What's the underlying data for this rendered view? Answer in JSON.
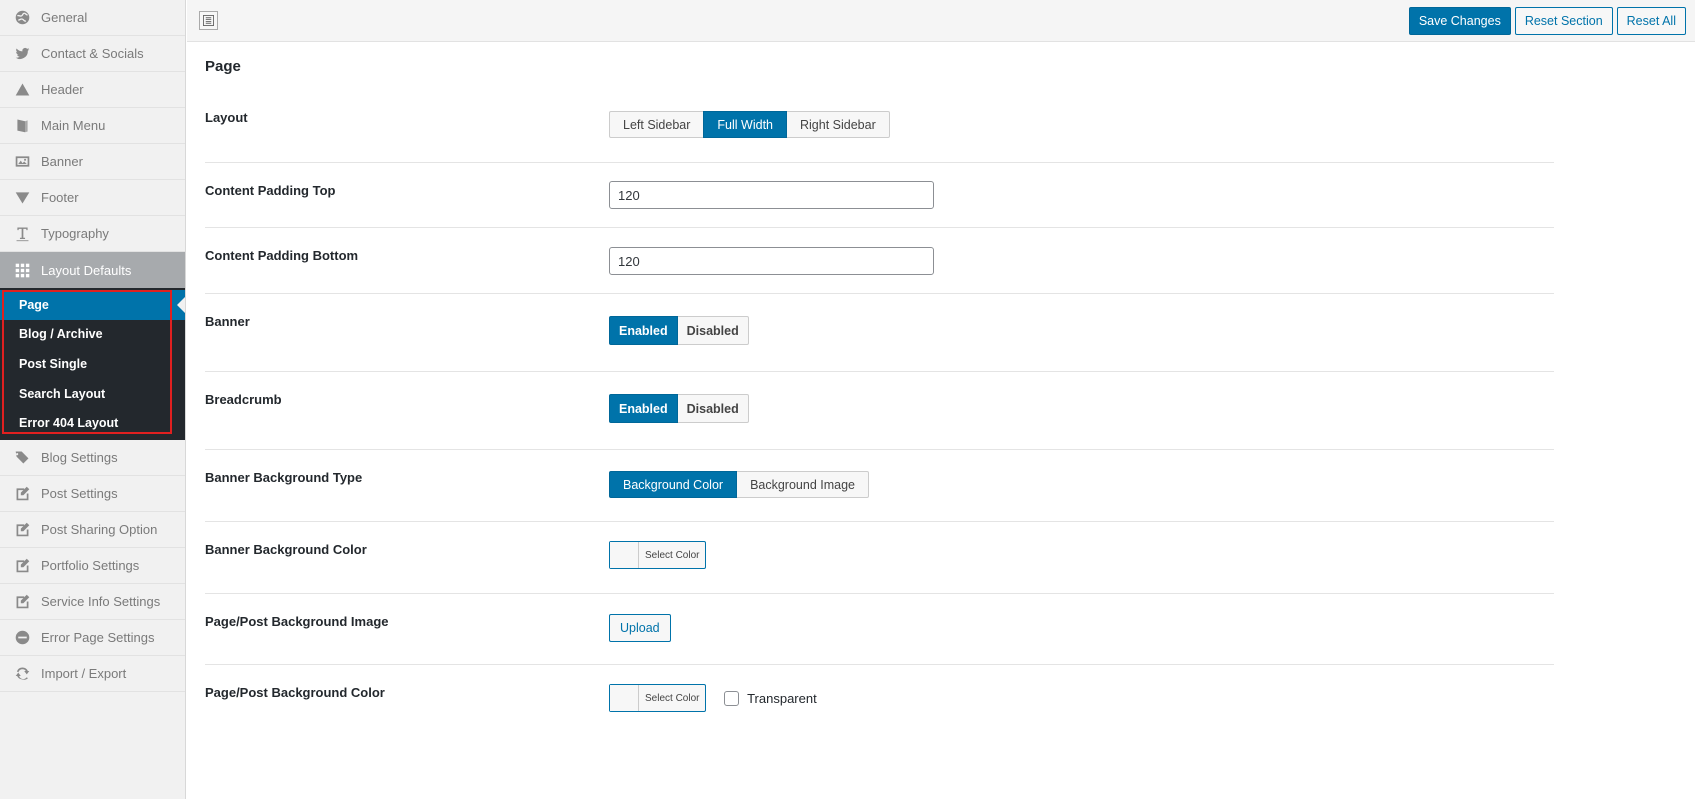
{
  "sidebar": {
    "items": [
      {
        "label": "General",
        "icon": "globe-icon"
      },
      {
        "label": "Contact & Socials",
        "icon": "twitter-icon"
      },
      {
        "label": "Header",
        "icon": "triangle-up-icon"
      },
      {
        "label": "Main Menu",
        "icon": "book-icon"
      },
      {
        "label": "Banner",
        "icon": "image-icon"
      },
      {
        "label": "Footer",
        "icon": "triangle-down-icon"
      },
      {
        "label": "Typography",
        "icon": "text-icon"
      },
      {
        "label": "Layout Defaults",
        "icon": "grid-icon"
      }
    ],
    "subitems": [
      "Page",
      "Blog / Archive",
      "Post Single",
      "Search Layout",
      "Error 404 Layout"
    ],
    "items_after": [
      {
        "label": "Blog Settings",
        "icon": "tags-icon"
      },
      {
        "label": "Post Settings",
        "icon": "edit-icon"
      },
      {
        "label": "Post Sharing Option",
        "icon": "edit-icon"
      },
      {
        "label": "Portfolio Settings",
        "icon": "edit-icon"
      },
      {
        "label": "Service Info Settings",
        "icon": "edit-icon"
      },
      {
        "label": "Error Page Settings",
        "icon": "minus-circle-icon"
      },
      {
        "label": "Import / Export",
        "icon": "refresh-icon"
      }
    ]
  },
  "toolbar": {
    "save_label": "Save Changes",
    "reset_section_label": "Reset Section",
    "reset_all_label": "Reset All"
  },
  "main": {
    "title": "Page",
    "layout": {
      "label": "Layout",
      "options": [
        "Left Sidebar",
        "Full Width",
        "Right Sidebar"
      ],
      "selected": "Full Width"
    },
    "padding_top": {
      "label": "Content Padding Top",
      "value": "120"
    },
    "padding_bottom": {
      "label": "Content Padding Bottom",
      "value": "120"
    },
    "banner": {
      "label": "Banner",
      "options": [
        "Enabled",
        "Disabled"
      ],
      "selected": "Enabled"
    },
    "breadcrumb": {
      "label": "Breadcrumb",
      "options": [
        "Enabled",
        "Disabled"
      ],
      "selected": "Enabled"
    },
    "banner_bg_type": {
      "label": "Banner Background Type",
      "options": [
        "Background Color",
        "Background Image"
      ],
      "selected": "Background Color"
    },
    "banner_bg_color": {
      "label": "Banner Background Color",
      "button": "Select Color"
    },
    "bg_image": {
      "label": "Page/Post Background Image",
      "button": "Upload"
    },
    "bg_color": {
      "label": "Page/Post Background Color",
      "button": "Select Color",
      "checkbox_label": "Transparent",
      "checked": false
    }
  },
  "colors": {
    "accent": "#0073aa",
    "sidebar_dark": "#23282d",
    "highlight_border": "#e02020"
  }
}
